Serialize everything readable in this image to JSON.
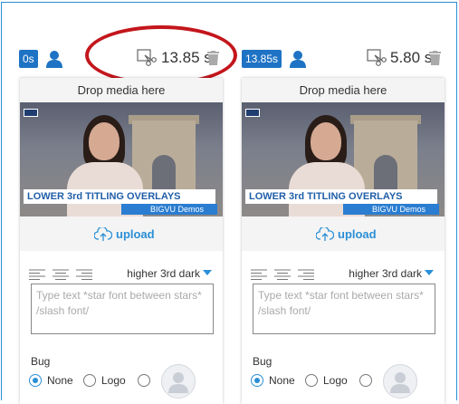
{
  "clips": [
    {
      "time_badge": "0s",
      "duration": "13.85 s",
      "drop_label": "Drop media here",
      "video": {
        "logo": "bigvu",
        "lower_third_title": "LOWER 3rd TITLING OVERLAYS",
        "lower_third_sub": "BIGVU Demos"
      },
      "upload_label": "upload",
      "style_selected": "higher 3rd dark",
      "text_placeholder": "Type text *star font between stars* /slash font/",
      "bug_label": "Bug",
      "bug_options": [
        "None",
        "Logo",
        ""
      ],
      "bug_selected": "None"
    },
    {
      "time_badge": "13.85s",
      "duration": "5.80 s",
      "drop_label": "Drop media here",
      "video": {
        "logo": "bigvu",
        "lower_third_title": "LOWER 3rd TITLING OVERLAYS",
        "lower_third_sub": "BIGVU Demos"
      },
      "upload_label": "upload",
      "style_selected": "higher 3rd dark",
      "text_placeholder": "Type text *star font between stars* /slash font/",
      "bug_label": "Bug",
      "bug_options": [
        "None",
        "Logo",
        ""
      ],
      "bug_selected": "None"
    }
  ],
  "icons": {
    "user": "user-icon",
    "cut": "scissors-cut-icon",
    "delete": "trash-icon",
    "upload": "cloud-upload-icon",
    "align_left": "align-left-icon",
    "align_center": "align-center-icon",
    "align_right": "align-right-icon",
    "avatar": "avatar-placeholder-icon"
  },
  "colors": {
    "accent": "#2a8fd6",
    "badge": "#1f73c4",
    "highlight": "#c3161c"
  }
}
